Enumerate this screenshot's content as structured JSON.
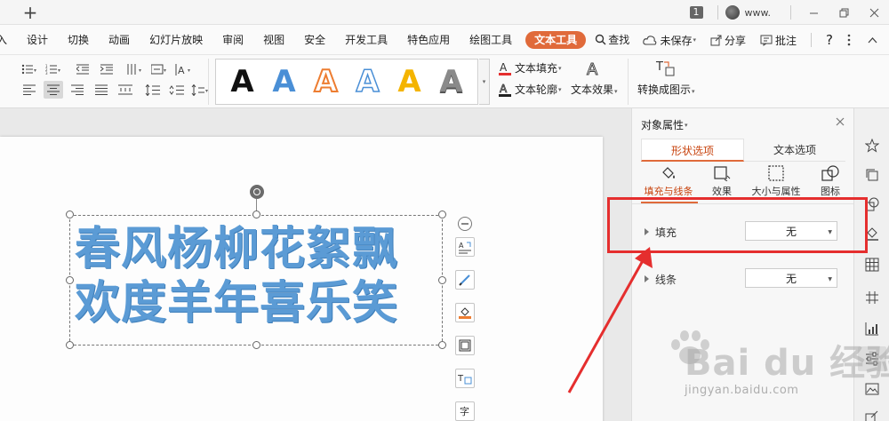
{
  "titlebar": {
    "new_tab_label": "+",
    "badge": "1",
    "user_name": "www."
  },
  "menu": {
    "items": [
      "入",
      "设计",
      "切换",
      "动画",
      "幻灯片放映",
      "审阅",
      "视图",
      "安全",
      "开发工具",
      "特色应用",
      "绘图工具",
      "文本工具"
    ],
    "active_index": 11,
    "search_label": "查找",
    "unsaved_label": "未保存",
    "share_label": "分享",
    "comment_label": "批注",
    "help_label": "?"
  },
  "ribbon": {
    "gallery_letter": "A",
    "gallery_styles": [
      "black",
      "blue",
      "orange-outline",
      "blue-outline",
      "gold",
      "gray-gradient"
    ],
    "text_fill_label": "文本填充",
    "text_outline_label": "文本轮廓",
    "text_effect_label": "文本效果",
    "convert_label": "转换成图示"
  },
  "slide": {
    "line1": "春风杨柳花絮飘",
    "line2": "欢度羊年喜乐笑",
    "text_color": "#5b9bd5",
    "float_tools": [
      "text-wrap-icon",
      "pen-icon",
      "fill-icon",
      "frame-icon",
      "text-box-icon",
      "char-icon"
    ]
  },
  "panel": {
    "title": "对象属性",
    "tabs": [
      "形状选项",
      "文本选项"
    ],
    "active_tab": 0,
    "sub_tabs": [
      "填充与线条",
      "效果",
      "大小与属性",
      "图标"
    ],
    "active_sub_tab": 0,
    "fill_label": "填充",
    "fill_value": "无",
    "line_label": "线条",
    "line_value": "无"
  },
  "watermark": {
    "main": "Bai du 经验",
    "sub": "jingyan.baidu.com"
  },
  "colors": {
    "accent": "#e06a3a",
    "annotation": "#e52e2e"
  }
}
